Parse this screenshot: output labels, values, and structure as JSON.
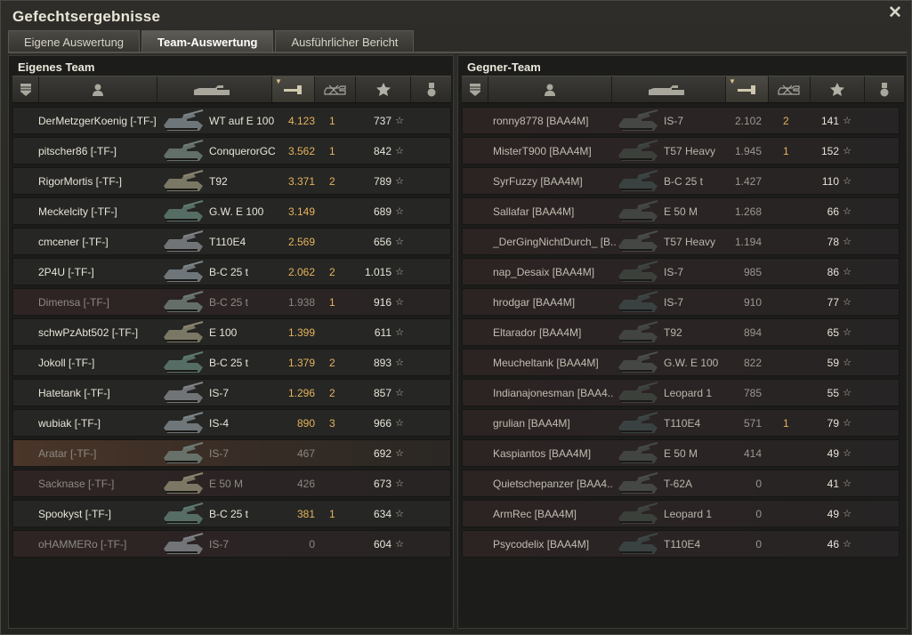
{
  "window": {
    "title": "Gefechtsergebnisse"
  },
  "tabs": [
    {
      "label": "Eigene Auswertung",
      "active": false
    },
    {
      "label": "Team-Auswertung",
      "active": true
    },
    {
      "label": "Ausführlicher Bericht",
      "active": false
    }
  ],
  "colors": {
    "accent": "#e5b35e",
    "panel_bg": "#1c1c1a",
    "row_bg": "#262624",
    "enemy_row": "#2c2323"
  },
  "columns": [
    {
      "icon": "squad-icon"
    },
    {
      "icon": "player-icon"
    },
    {
      "icon": "tank-icon"
    },
    {
      "icon": "damage-icon",
      "sorted": true
    },
    {
      "icon": "kills-icon"
    },
    {
      "icon": "xp-star-icon"
    },
    {
      "icon": "medal-icon"
    }
  ],
  "own_team": {
    "title": "Eigenes Team",
    "rows": [
      {
        "name": "DerMetzgerKoenig [-TF-]",
        "tank": "WT auf E 100",
        "damage": "4.123",
        "kills": "1",
        "xp": "737",
        "state": "alive"
      },
      {
        "name": "pitscher86 [-TF-]",
        "tank": "ConquerorGC",
        "damage": "3.562",
        "kills": "1",
        "xp": "842",
        "state": "alive"
      },
      {
        "name": "RigorMortis [-TF-]",
        "tank": "T92",
        "damage": "3.371",
        "kills": "2",
        "xp": "789",
        "state": "alive"
      },
      {
        "name": "Meckelcity [-TF-]",
        "tank": "G.W. E 100",
        "damage": "3.149",
        "kills": "",
        "xp": "689",
        "state": "alive"
      },
      {
        "name": "cmcener [-TF-]",
        "tank": "T110E4",
        "damage": "2.569",
        "kills": "",
        "xp": "656",
        "state": "alive"
      },
      {
        "name": "2P4U [-TF-]",
        "tank": "B-C 25 t",
        "damage": "2.062",
        "kills": "2",
        "xp": "1.015",
        "state": "alive"
      },
      {
        "name": "Dimensa [-TF-]",
        "tank": "B-C 25 t",
        "damage": "1.938",
        "kills": "1",
        "xp": "916",
        "state": "dead"
      },
      {
        "name": "schwPzAbt502 [-TF-]",
        "tank": "E 100",
        "damage": "1.399",
        "kills": "",
        "xp": "611",
        "state": "alive"
      },
      {
        "name": "Jokoll [-TF-]",
        "tank": "B-C 25 t",
        "damage": "1.379",
        "kills": "2",
        "xp": "893",
        "state": "alive"
      },
      {
        "name": "Hatetank [-TF-]",
        "tank": "IS-7",
        "damage": "1.296",
        "kills": "2",
        "xp": "857",
        "state": "alive"
      },
      {
        "name": "wubiak [-TF-]",
        "tank": "IS-4",
        "damage": "890",
        "kills": "3",
        "xp": "966",
        "state": "alive"
      },
      {
        "name": "Aratar [-TF-]",
        "tank": "IS-7",
        "damage": "467",
        "kills": "",
        "xp": "692",
        "state": "selected"
      },
      {
        "name": "Sacknase [-TF-]",
        "tank": "E 50 M",
        "damage": "426",
        "kills": "",
        "xp": "673",
        "state": "dead"
      },
      {
        "name": "Spookyst [-TF-]",
        "tank": "B-C 25 t",
        "damage": "381",
        "kills": "1",
        "xp": "634",
        "state": "alive"
      },
      {
        "name": "oHAMMERo [-TF-]",
        "tank": "IS-7",
        "damage": "0",
        "kills": "",
        "xp": "604",
        "state": "dead"
      }
    ]
  },
  "enemy_team": {
    "title": "Gegner-Team",
    "rows": [
      {
        "name": "ronny8778 [BAA4M]",
        "tank": "IS-7",
        "damage": "2.102",
        "kills": "2",
        "xp": "141"
      },
      {
        "name": "MisterT900 [BAA4M]",
        "tank": "T57 Heavy",
        "damage": "1.945",
        "kills": "1",
        "xp": "152"
      },
      {
        "name": "SyrFuzzy [BAA4M]",
        "tank": "B-C 25 t",
        "damage": "1.427",
        "kills": "",
        "xp": "110"
      },
      {
        "name": "Sallafar [BAA4M]",
        "tank": "E 50 M",
        "damage": "1.268",
        "kills": "",
        "xp": "66"
      },
      {
        "name": "_DerGingNichtDurch_ [B..",
        "tank": "T57 Heavy",
        "damage": "1.194",
        "kills": "",
        "xp": "78"
      },
      {
        "name": "nap_Desaix [BAA4M]",
        "tank": "IS-7",
        "damage": "985",
        "kills": "",
        "xp": "86"
      },
      {
        "name": "hrodgar [BAA4M]",
        "tank": "IS-7",
        "damage": "910",
        "kills": "",
        "xp": "77"
      },
      {
        "name": "Eltarador [BAA4M]",
        "tank": "T92",
        "damage": "894",
        "kills": "",
        "xp": "65"
      },
      {
        "name": "Meucheltank [BAA4M]",
        "tank": "G.W. E 100",
        "damage": "822",
        "kills": "",
        "xp": "59"
      },
      {
        "name": "Indianajonesman [BAA4..",
        "tank": "Leopard 1",
        "damage": "785",
        "kills": "",
        "xp": "55"
      },
      {
        "name": "grulian [BAA4M]",
        "tank": "T110E4",
        "damage": "571",
        "kills": "1",
        "xp": "79"
      },
      {
        "name": "Kaspiantos [BAA4M]",
        "tank": "E 50 M",
        "damage": "414",
        "kills": "",
        "xp": "49"
      },
      {
        "name": "Quietschepanzer [BAA4..",
        "tank": "T-62A",
        "damage": "0",
        "kills": "",
        "xp": "41"
      },
      {
        "name": "ArmRec [BAA4M]",
        "tank": "Leopard 1",
        "damage": "0",
        "kills": "",
        "xp": "49"
      },
      {
        "name": "Psycodelix [BAA4M]",
        "tank": "T110E4",
        "damage": "0",
        "kills": "",
        "xp": "46"
      }
    ]
  }
}
